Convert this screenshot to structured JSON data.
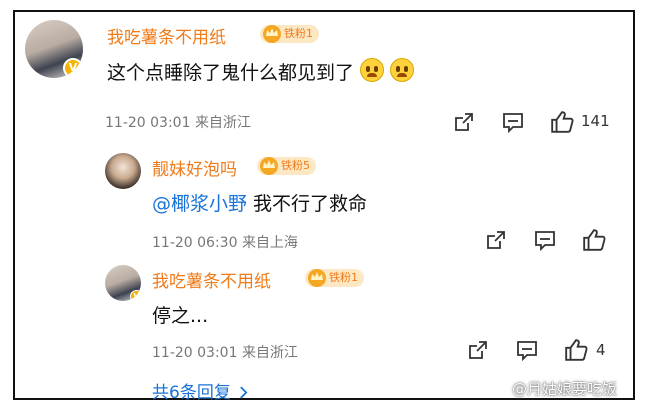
{
  "comment": {
    "username": "我吃薯条不用纸",
    "badge": "铁粉1",
    "text": "这个点睡除了鬼什么都见到了",
    "date": "11-20 03:01",
    "location": "来自浙江",
    "likes": "141"
  },
  "replies": [
    {
      "username": "靓妹好泡吗",
      "badge": "铁粉5",
      "mention": "@椰浆小野",
      "text": " 我不行了救命",
      "date": "11-20 06:30",
      "location": "来自上海",
      "likes": ""
    },
    {
      "username": "我吃薯条不用纸",
      "badge": "铁粉1",
      "text": "停之...",
      "date": "11-20 03:01",
      "location": "来自浙江",
      "likes": "4"
    }
  ],
  "more_replies": "共6条回复",
  "watermark": "@月姑娘要吃饭",
  "colors": {
    "username": "#f07b19",
    "mention": "#1a73d9",
    "badge_bg": "#fde8c4",
    "verified": "#f5b400"
  },
  "icons": [
    "share-icon",
    "comment-icon",
    "like-icon",
    "verified-icon",
    "crown-icon",
    "chevron-right-icon"
  ]
}
